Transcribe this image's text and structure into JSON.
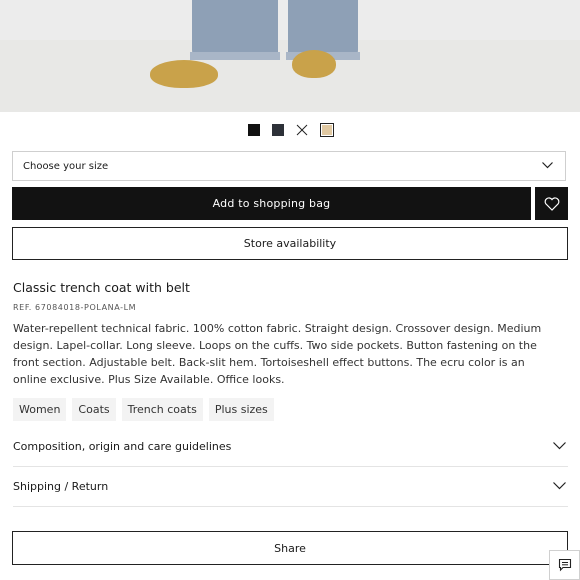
{
  "colors": {
    "swatches": [
      "#111111",
      "#2d3138",
      "#ffffff",
      "#e1c9a2"
    ]
  },
  "size_select": {
    "placeholder": "Choose your size"
  },
  "actions": {
    "add_to_bag": "Add to shopping bag",
    "store_availability": "Store availability",
    "share": "Share"
  },
  "product": {
    "title": "Classic trench coat with belt",
    "ref": "REF. 67084018-POLANA-LM",
    "description": "Water-repellent technical fabric. 100% cotton fabric. Straight design. Crossover design. Medium design. Lapel-collar. Long sleeve. Loops on the cuffs. Two side pockets. Button fastening on the front section. Adjustable belt. Back-slit hem. Tortoiseshell effect buttons. The ecru color is an online exclusive. Plus Size Available. Office looks.",
    "tags": [
      "Women",
      "Coats",
      "Trench coats",
      "Plus sizes"
    ]
  },
  "accordions": {
    "composition": "Composition, origin and care guidelines",
    "shipping": "Shipping / Return"
  }
}
